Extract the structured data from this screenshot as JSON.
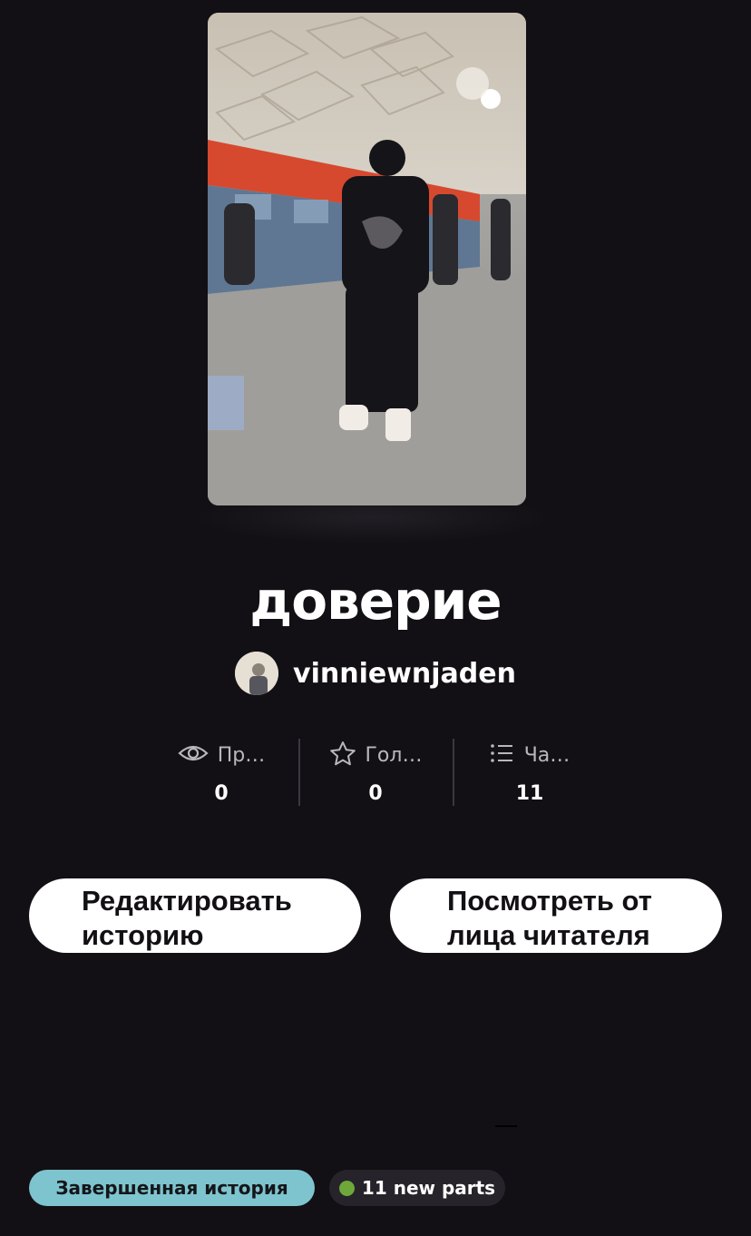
{
  "story": {
    "title": "доверие",
    "author": "vinniewnjaden"
  },
  "stats": [
    {
      "icon": "eye-icon",
      "label": "Пр…",
      "value": "0"
    },
    {
      "icon": "star-icon",
      "label": "Гол…",
      "value": "0"
    },
    {
      "icon": "list-icon",
      "label": "Ча…",
      "value": "11"
    }
  ],
  "actions": {
    "edit_label": "Редактировать историю",
    "preview_label": "Посмотреть от лица читателя"
  },
  "badges": {
    "status": "Завершенная история",
    "new_parts": "11 new parts"
  },
  "colors": {
    "background": "#121014",
    "status_badge": "#7ec4cf",
    "new_parts_dot": "#6ea83a"
  }
}
